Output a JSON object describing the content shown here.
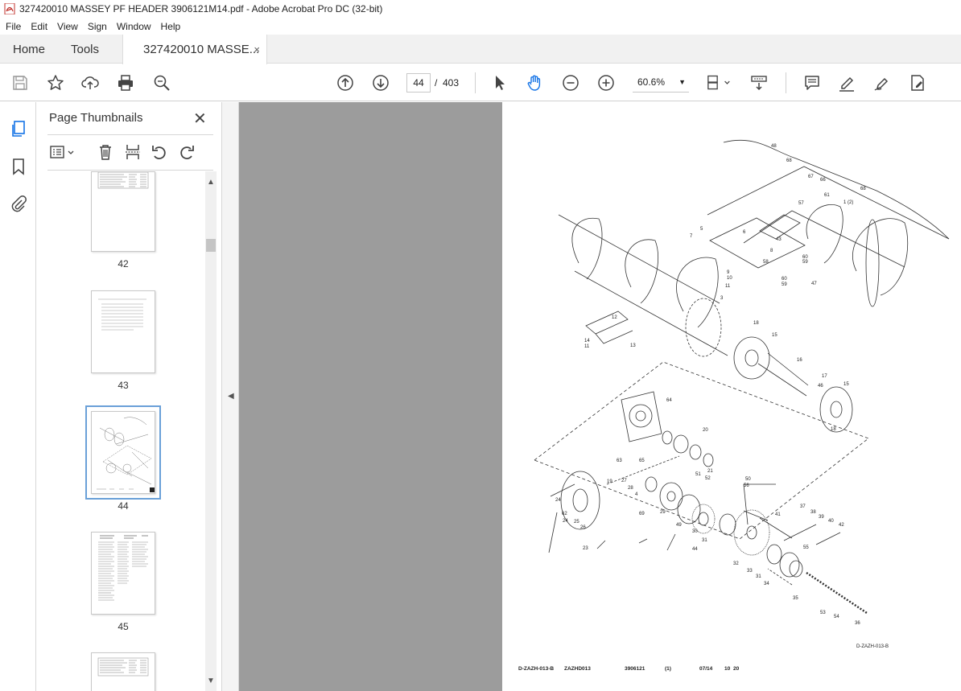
{
  "window": {
    "title": "327420010 MASSEY PF HEADER 3906121M14.pdf - Adobe Acrobat Pro DC (32-bit)"
  },
  "menu": [
    "File",
    "Edit",
    "View",
    "Sign",
    "Window",
    "Help"
  ],
  "tabs": {
    "home": "Home",
    "tools": "Tools",
    "doc": "327420010 MASSE...",
    "close": "×"
  },
  "toolbar": {
    "current_page": "44",
    "page_sep": "/",
    "total_pages": "403",
    "zoom": "60.6%"
  },
  "thumbnail_panel": {
    "title": "Page Thumbnails",
    "close": "✕",
    "pages": [
      {
        "label": "42",
        "selected": false
      },
      {
        "label": "43",
        "selected": false
      },
      {
        "label": "44",
        "selected": true
      },
      {
        "label": "45",
        "selected": false
      }
    ]
  },
  "drawing": {
    "callouts": [
      "48",
      "68",
      "67",
      "66",
      "68",
      "57",
      "61",
      "1 (2)",
      "5",
      "7",
      "6",
      "43",
      "8",
      "58",
      "60",
      "59",
      "60",
      "59",
      "47",
      "9",
      "10",
      "11",
      "3",
      "12",
      "14",
      "11",
      "13",
      "18",
      "15",
      "16",
      "17",
      "46",
      "15",
      "18",
      "64",
      "63",
      "65",
      "20",
      "21",
      "51",
      "52",
      "27",
      "28",
      "4",
      "69",
      "29",
      "49",
      "30",
      "31",
      "19",
      "24",
      "62",
      "24",
      "25",
      "26",
      "23",
      "50",
      "56",
      "41",
      "37",
      "38",
      "39",
      "40",
      "42",
      "55",
      "32",
      "33",
      "31",
      "34",
      "35",
      "53",
      "54",
      "36",
      "44"
    ],
    "figure_ref": "D-ZAZH-013-B",
    "footer": {
      "ref": "D-ZAZH-013-B",
      "code": "ZAZHD013",
      "part": "3906121",
      "qty": "(1)",
      "date": "07/14",
      "num": "10",
      "num2": "20"
    }
  },
  "colors": {
    "accent": "#1473e6",
    "page_bg": "#9c9c9c"
  }
}
